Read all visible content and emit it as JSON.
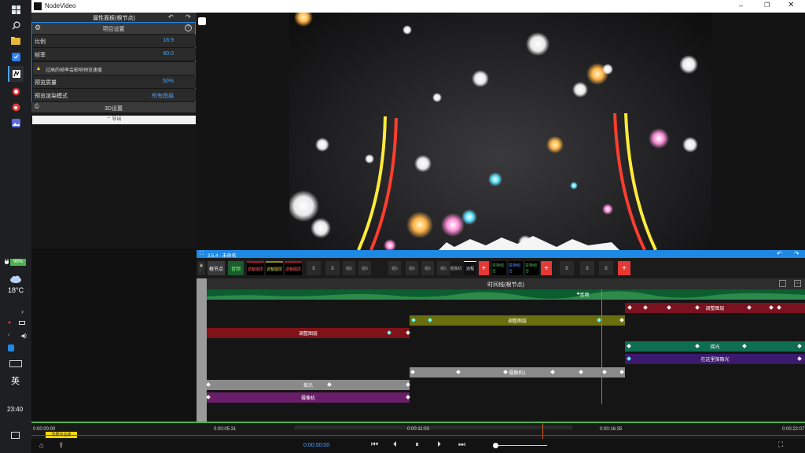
{
  "os": {
    "battery": "98%",
    "weather_temp": "18°C",
    "ime": "英",
    "clock": "23:40"
  },
  "window": {
    "title": "NodeVideo"
  },
  "props_panel": {
    "header": "属性面板(根节点)",
    "section_title": "项目设置",
    "rows": [
      {
        "label": "比例",
        "value": "16:9"
      },
      {
        "label": "帧率",
        "value": "60.0"
      }
    ],
    "warning": "过高的帧率会影响预览速度",
    "rows2": [
      {
        "label": "预览质量",
        "value": "50%"
      },
      {
        "label": "预览渲染模式",
        "value": "所有图层"
      }
    ],
    "section3d": "3D设置",
    "export_label": "导出"
  },
  "node_editor": {
    "title": "3.5.4 - 未命名",
    "root_label": "根节点",
    "audio_label": "音频",
    "toolbar_chips": [
      "调整图层",
      "调整图层",
      "调整图层",
      "组5",
      "组5",
      "组5",
      "组5",
      "组5",
      "组5",
      "摄像机",
      "远程",
      "变换组合",
      "变换组合",
      "变换组合"
    ],
    "timeline_title": "时间线(根节点)"
  },
  "clips": [
    {
      "label": "音频",
      "color": "#0b5e2f"
    },
    {
      "label": "调整图层",
      "color": "#7a1220"
    },
    {
      "label": "调整图层",
      "color": "#6b6e0f"
    },
    {
      "label": "调整图层",
      "color": "#801318"
    },
    {
      "label": "摇光",
      "color": "#0f6e52"
    },
    {
      "label": "在这里渐隐光",
      "color": "#3c1a6e"
    },
    {
      "label": "摄像机1",
      "color": "#8a8a8a"
    },
    {
      "label": "摇光",
      "color": "#8a8a8a"
    },
    {
      "label": "摄像机",
      "color": "#6a1e6a"
    }
  ],
  "ruler": {
    "times": [
      "0:00:00:00",
      "0:00:05:31",
      "0:00:11:03",
      "0:00:16:35",
      "0:00:22:07"
    ],
    "badge": "需要专业版"
  },
  "transport": {
    "timecode": "0:00:00:00"
  },
  "colors": {
    "accent": "#1e88e5",
    "playhead": "#e0622a",
    "add_button": "#e53935"
  }
}
